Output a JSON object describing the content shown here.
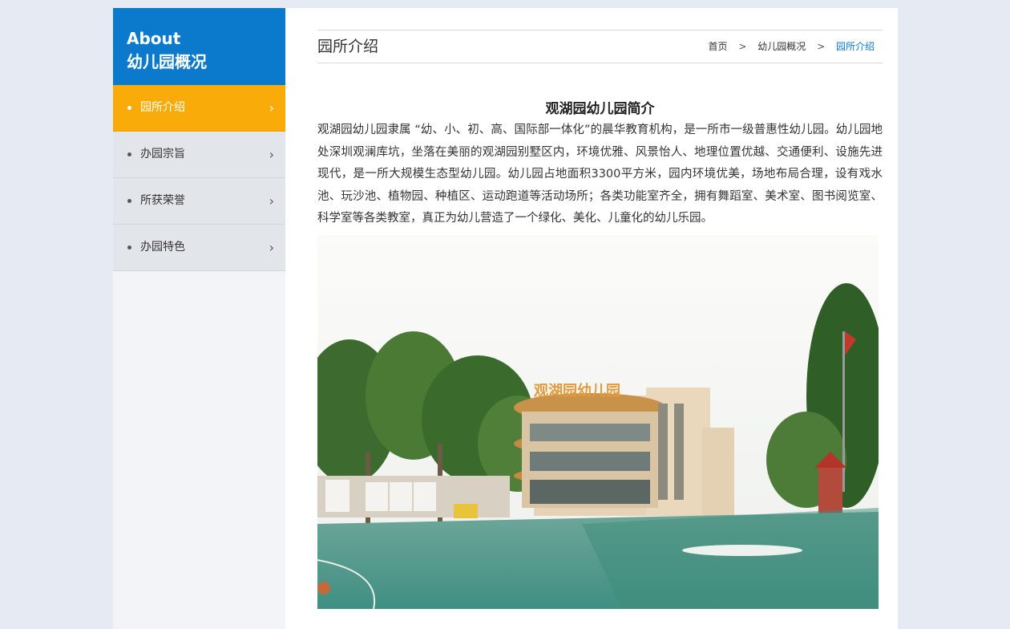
{
  "sidebar": {
    "title_en": "About",
    "title_zh": "幼儿园概况",
    "items": [
      {
        "label": "园所介绍",
        "active": true
      },
      {
        "label": "办园宗旨",
        "active": false
      },
      {
        "label": "所获荣誉",
        "active": false
      },
      {
        "label": "办园特色",
        "active": false
      }
    ]
  },
  "main": {
    "page_title": "园所介绍",
    "breadcrumb": {
      "home": "首页",
      "section": "幼儿园概况",
      "current": "园所介绍",
      "separator": ">"
    },
    "article": {
      "title": "观湖园幼儿园简介",
      "body": "观湖园幼儿园隶属 “幼、小、初、高、国际部一体化”的晨华教育机构，是一所市一级普惠性幼儿园。幼儿园地处深圳观澜库坑，坐落在美丽的观湖园别墅区内，环境优雅、风景怡人、地理位置优越、交通便利、设施先进现代，是一所大规模生态型幼儿园。幼儿园占地面积3300平方米，园内环境优美，场地布局合理，设有戏水池、玩沙池、植物园、种植区、运动跑道等活动场所；各类功能室齐全，拥有舞蹈室、美术室、图书阅览室、科学室等各类教室，真正为幼儿营造了一个绿化、美化、儿童化的幼儿乐园。"
    }
  },
  "colors": {
    "accent_blue": "#0c7acc",
    "active_orange": "#f8ab09",
    "page_bg": "#e6ebf3"
  },
  "icons": {
    "menu_arrow": "chevron-right-icon",
    "menu_dot": "bullet-icon"
  }
}
